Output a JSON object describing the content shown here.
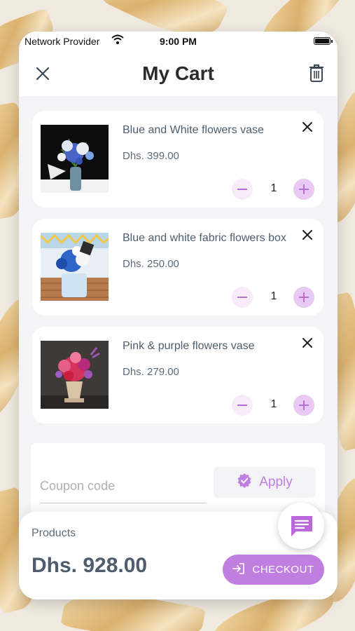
{
  "status_bar": {
    "provider": "Network Provider",
    "time": "9:00 PM"
  },
  "header": {
    "title": "My Cart"
  },
  "cart_items": [
    {
      "name": "Blue and White flowers vase",
      "price": "Dhs. 399.00",
      "quantity": "1"
    },
    {
      "name": "Blue and white fabric flowers box",
      "price": "Dhs. 250.00",
      "quantity": "1"
    },
    {
      "name": "Pink & purple flowers vase",
      "price": "Dhs. 279.00",
      "quantity": "1"
    }
  ],
  "coupon": {
    "placeholder": "Coupon code",
    "apply_label": "Apply"
  },
  "summary": {
    "products_label": "Products",
    "total": "Dhs. 928.00",
    "checkout_label": "CHECKOUT"
  },
  "colors": {
    "accent": "#c07ee0",
    "text_primary": "#4e5d6e"
  },
  "icons": [
    "close-icon",
    "trash-icon",
    "remove-item-icon",
    "minus-icon",
    "plus-icon",
    "verified-badge-icon",
    "login-icon",
    "chat-icon",
    "wifi-icon",
    "battery-icon"
  ]
}
